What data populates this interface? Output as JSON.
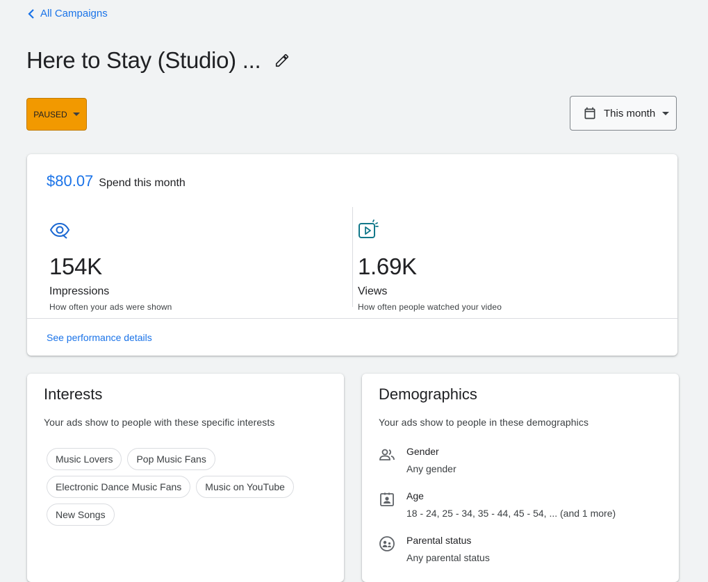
{
  "nav": {
    "back_label": "All Campaigns"
  },
  "header": {
    "title": "Here to Stay (Studio) ...",
    "status": "PAUSED",
    "date_range": "This month"
  },
  "spend": {
    "value": "$80.07",
    "label": "Spend this month"
  },
  "metrics": [
    {
      "value": "154K",
      "label": "Impressions",
      "description": "How often your ads were shown",
      "icon": "eye-icon"
    },
    {
      "value": "1.69K",
      "label": "Views",
      "description": "How often people watched your video",
      "icon": "video-play-icon"
    }
  ],
  "performance_link": "See performance details",
  "interests": {
    "title": "Interests",
    "subtitle": "Your ads show to people with these specific interests",
    "chips": [
      "Music Lovers",
      "Pop Music Fans",
      "Electronic Dance Music Fans",
      "Music on YouTube",
      "New Songs"
    ]
  },
  "demographics": {
    "title": "Demographics",
    "subtitle": "Your ads show to people in these demographics",
    "rows": [
      {
        "label": "Gender",
        "value": "Any gender",
        "icon": "people-icon"
      },
      {
        "label": "Age",
        "value": "18 - 24, 25 - 34, 35 - 44, 45 - 54, ... (and 1 more)",
        "icon": "id-badge-icon"
      },
      {
        "label": "Parental status",
        "value": "Any parental status",
        "icon": "family-icon"
      }
    ]
  },
  "colors": {
    "accent": "#1a73e8",
    "paused": "#f29900",
    "background": "#f1f3f4"
  }
}
